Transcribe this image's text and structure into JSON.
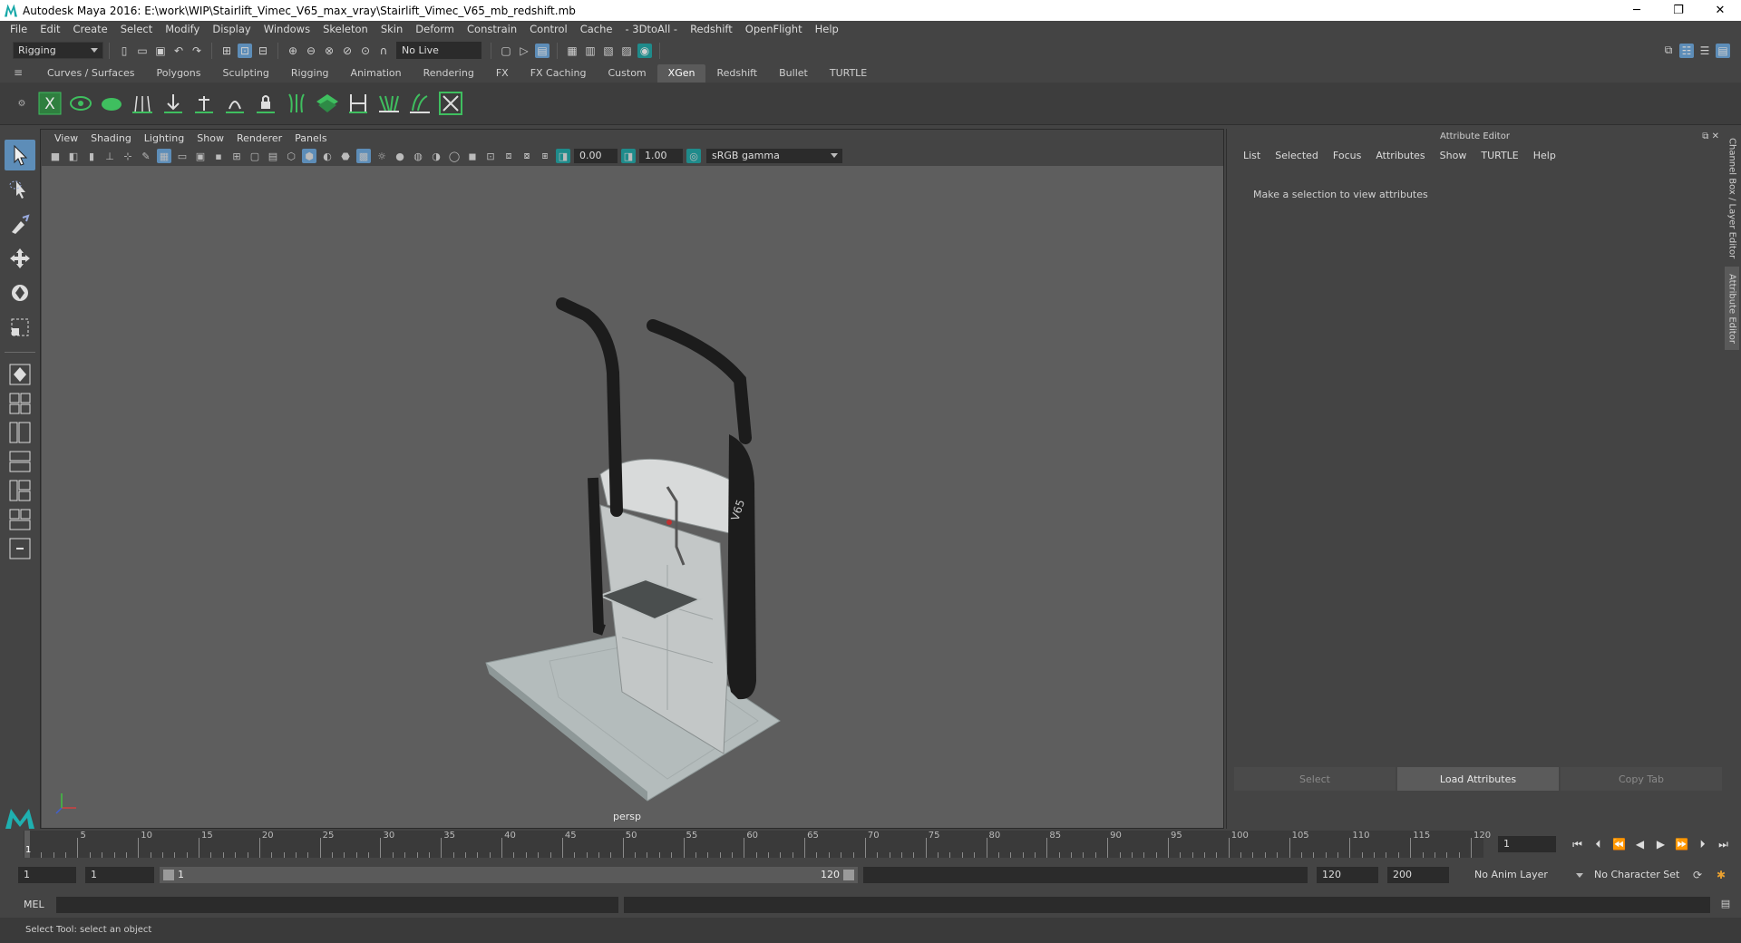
{
  "window": {
    "title": "Autodesk Maya 2016: E:\\work\\WIP\\Stairlift_Vimec_V65_max_vray\\Stairlift_Vimec_V65_mb_redshift.mb",
    "minimize": "─",
    "maximize": "❐",
    "close": "✕"
  },
  "menu": [
    "File",
    "Edit",
    "Create",
    "Select",
    "Modify",
    "Display",
    "Windows",
    "Skeleton",
    "Skin",
    "Deform",
    "Constrain",
    "Control",
    "Cache",
    "- 3DtoAll -",
    "Redshift",
    "OpenFlight",
    "Help"
  ],
  "status": {
    "mode": "Rigging",
    "live_surface": "No Live Surface"
  },
  "shelf_tabs": [
    "Curves / Surfaces",
    "Polygons",
    "Sculpting",
    "Rigging",
    "Animation",
    "Rendering",
    "FX",
    "FX Caching",
    "Custom",
    "XGen",
    "Redshift",
    "Bullet",
    "TURTLE"
  ],
  "active_shelf_tab": "XGen",
  "viewport": {
    "menu": [
      "View",
      "Shading",
      "Lighting",
      "Show",
      "Renderer",
      "Panels"
    ],
    "exposure": "0.00",
    "gamma": "1.00",
    "color_space": "sRGB gamma",
    "camera": "persp"
  },
  "attribute_editor": {
    "title": "Attribute Editor",
    "menu": [
      "List",
      "Selected",
      "Focus",
      "Attributes",
      "Show",
      "TURTLE",
      "Help"
    ],
    "message": "Make a selection to view attributes",
    "buttons": {
      "select": "Select",
      "load": "Load Attributes",
      "copy": "Copy Tab"
    }
  },
  "side_tabs": {
    "channel_box": "Channel Box / Layer Editor",
    "attribute_editor": "Attribute Editor"
  },
  "timeline": {
    "ticks": [
      "5",
      "10",
      "15",
      "20",
      "25",
      "30",
      "35",
      "40",
      "45",
      "50",
      "55",
      "60",
      "65",
      "70",
      "75",
      "80",
      "85",
      "90",
      "95",
      "100",
      "105",
      "110",
      "115",
      "120"
    ],
    "current_frame": "1",
    "current_frame_field": "1"
  },
  "range": {
    "start": "1",
    "playback_start": "1",
    "range_start_label": "1",
    "range_end_label": "120",
    "playback_end": "120",
    "end": "200",
    "anim_layer": "No Anim Layer",
    "character_set": "No Character Set"
  },
  "command": {
    "label": "MEL"
  },
  "help_line": "Select Tool: select an object",
  "colors": {
    "accent": "#5d8db8",
    "xgen_green": "#3fbf5f",
    "viewport_bg": "#5e5e5e",
    "panel": "#444444"
  }
}
